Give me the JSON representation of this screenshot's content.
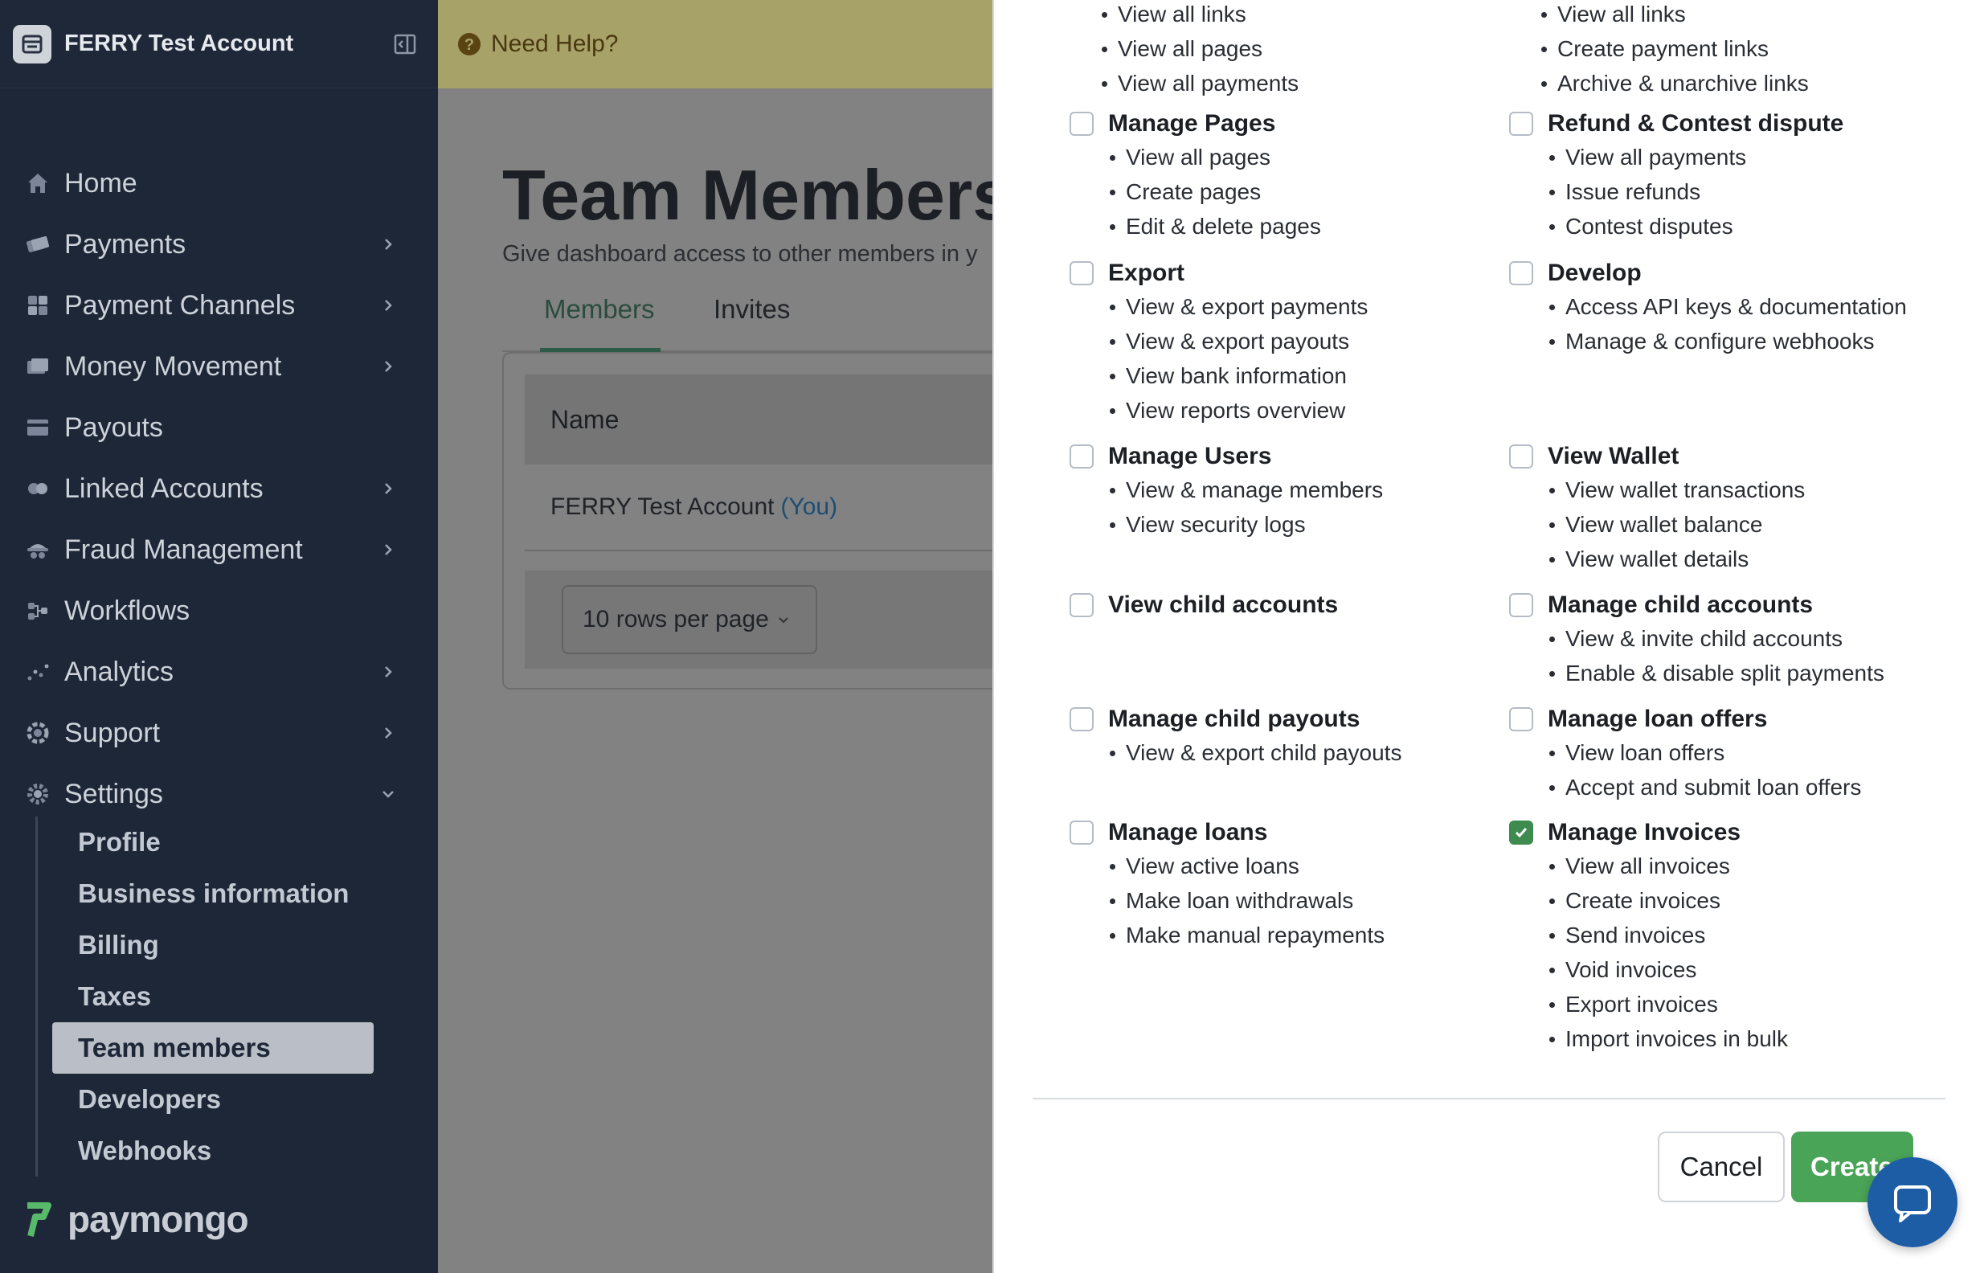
{
  "sidebar": {
    "account_name": "FERRY Test Account",
    "nav": [
      {
        "label": "Home",
        "icon": "home-icon",
        "chevron": false
      },
      {
        "label": "Payments",
        "icon": "payments-icon",
        "chevron": true
      },
      {
        "label": "Payment Channels",
        "icon": "payment-channels-icon",
        "chevron": true
      },
      {
        "label": "Money Movement",
        "icon": "money-movement-icon",
        "chevron": true
      },
      {
        "label": "Payouts",
        "icon": "payouts-icon",
        "chevron": false
      },
      {
        "label": "Linked Accounts",
        "icon": "linked-accounts-icon",
        "chevron": true
      },
      {
        "label": "Fraud Management",
        "icon": "fraud-management-icon",
        "chevron": true
      },
      {
        "label": "Workflows",
        "icon": "workflows-icon",
        "chevron": false
      },
      {
        "label": "Analytics",
        "icon": "analytics-icon",
        "chevron": true
      },
      {
        "label": "Support",
        "icon": "support-icon",
        "chevron": true
      },
      {
        "label": "Settings",
        "icon": "settings-icon",
        "chevron": "down"
      }
    ],
    "settings_items": [
      "Profile",
      "Business information",
      "Billing",
      "Taxes",
      "Team members",
      "Developers",
      "Webhooks"
    ],
    "active_settings_item": "Team members",
    "brand": "paymongo"
  },
  "header": {
    "help": "Need Help?"
  },
  "main": {
    "title": "Team Members",
    "subtitle": "Give dashboard access to other members in y",
    "tabs": [
      "Members",
      "Invites"
    ],
    "active_tab": "Members",
    "table": {
      "column": "Name",
      "row_name": "FERRY Test Account",
      "row_you": "(You)"
    },
    "rows_per_page": "10 rows per page"
  },
  "panel": {
    "top_left_items": [
      "View all links",
      "View all pages",
      "View all payments"
    ],
    "top_right_items": [
      "View all links",
      "Create payment links",
      "Archive & unarchive links"
    ],
    "permissions": {
      "manage_pages": {
        "title": "Manage Pages",
        "items": [
          "View all pages",
          "Create pages",
          "Edit & delete pages"
        ],
        "checked": false
      },
      "refund_contest": {
        "title": "Refund & Contest dispute",
        "items": [
          "View all payments",
          "Issue refunds",
          "Contest disputes"
        ],
        "checked": false
      },
      "export": {
        "title": "Export",
        "items": [
          "View & export payments",
          "View & export payouts",
          "View bank information",
          "View reports overview"
        ],
        "checked": false
      },
      "develop": {
        "title": "Develop",
        "items": [
          "Access API keys & documentation",
          "Manage & configure webhooks"
        ],
        "checked": false
      },
      "manage_users": {
        "title": "Manage Users",
        "items": [
          "View & manage members",
          "View security logs"
        ],
        "checked": false
      },
      "view_wallet": {
        "title": "View Wallet",
        "items": [
          "View wallet transactions",
          "View wallet balance",
          "View wallet details"
        ],
        "checked": false
      },
      "view_child_accounts": {
        "title": "View child accounts",
        "items": [],
        "checked": false
      },
      "manage_child_accounts": {
        "title": "Manage child accounts",
        "items": [
          "View & invite child accounts",
          "Enable & disable split payments"
        ],
        "checked": false
      },
      "manage_child_payouts": {
        "title": "Manage child payouts",
        "items": [
          "View & export child payouts"
        ],
        "checked": false
      },
      "manage_loan_offers": {
        "title": "Manage loan offers",
        "items": [
          "View loan offers",
          "Accept and submit loan offers"
        ],
        "checked": false
      },
      "manage_loans": {
        "title": "Manage loans",
        "items": [
          "View active loans",
          "Make loan withdrawals",
          "Make manual repayments"
        ],
        "checked": false
      },
      "manage_invoices": {
        "title": "Manage Invoices",
        "items": [
          "View all invoices",
          "Create invoices",
          "Send invoices",
          "Void invoices",
          "Export invoices",
          "Import invoices in bulk"
        ],
        "checked": true
      }
    },
    "cancel_label": "Cancel",
    "create_label": "Create"
  }
}
